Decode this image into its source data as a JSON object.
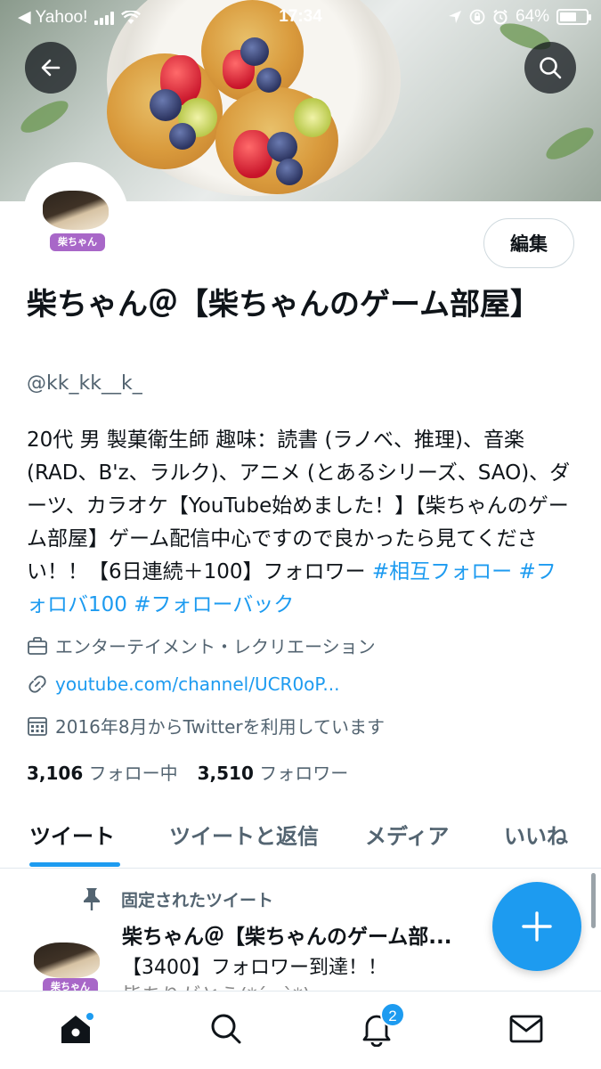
{
  "status_bar": {
    "carrier": "◀ Yahoo!",
    "time": "17:34",
    "battery": "64%",
    "battery_level": 0.64
  },
  "profile": {
    "name": "柴ちゃん＠【柴ちゃんのゲーム部屋】",
    "handle": "@kk_kk__k_",
    "avatar_label": "柴ちゃん",
    "edit_label": "編集",
    "bio_text": "20代 男 製菓衛生師 趣味：読書 (ラノベ、推理)、音楽 (RAD、B'z、ラルク)、アニメ (とあるシリーズ、SAO)、ダーツ、カラオケ【YouTube始めました！】【柴ちゃんのゲーム部屋】ゲーム配信中心ですので良かったら見てください！！【6日連続＋100】フォロワー ",
    "bio_tags": [
      "#相互フォロー",
      "#フォロバ100",
      "#フォローバック"
    ],
    "category": "エンターテイメント・レクリエーション",
    "link": "youtube.com/channel/UCR0oP...",
    "joined": "2016年8月からTwitterを利用しています",
    "following_count": "3,106",
    "following_label": "フォロー中",
    "followers_count": "3,510",
    "followers_label": "フォロワー"
  },
  "tabs": [
    {
      "label": "ツイート",
      "active": true
    },
    {
      "label": "ツイートと返信",
      "active": false
    },
    {
      "label": "メディア",
      "active": false
    },
    {
      "label": "いいね",
      "active": false
    }
  ],
  "pinned_tweet": {
    "pinned_label": "固定されたツイート",
    "author": "柴ちゃん＠【柴ちゃんのゲーム部...",
    "text_line1": "【3400】フォロワー到達！！",
    "text_line2": "皆ありがとう(*´ω`*)"
  },
  "bottom_nav": {
    "notification_count": "2"
  },
  "colors": {
    "accent": "#1d9bf0",
    "text_primary": "#0f1419",
    "text_secondary": "#536471"
  },
  "icons": [
    "back-arrow-icon",
    "search-icon",
    "briefcase-icon",
    "link-icon",
    "calendar-icon",
    "pin-icon",
    "compose-plus-icon",
    "home-icon",
    "explore-search-icon",
    "bell-icon",
    "mail-icon"
  ]
}
